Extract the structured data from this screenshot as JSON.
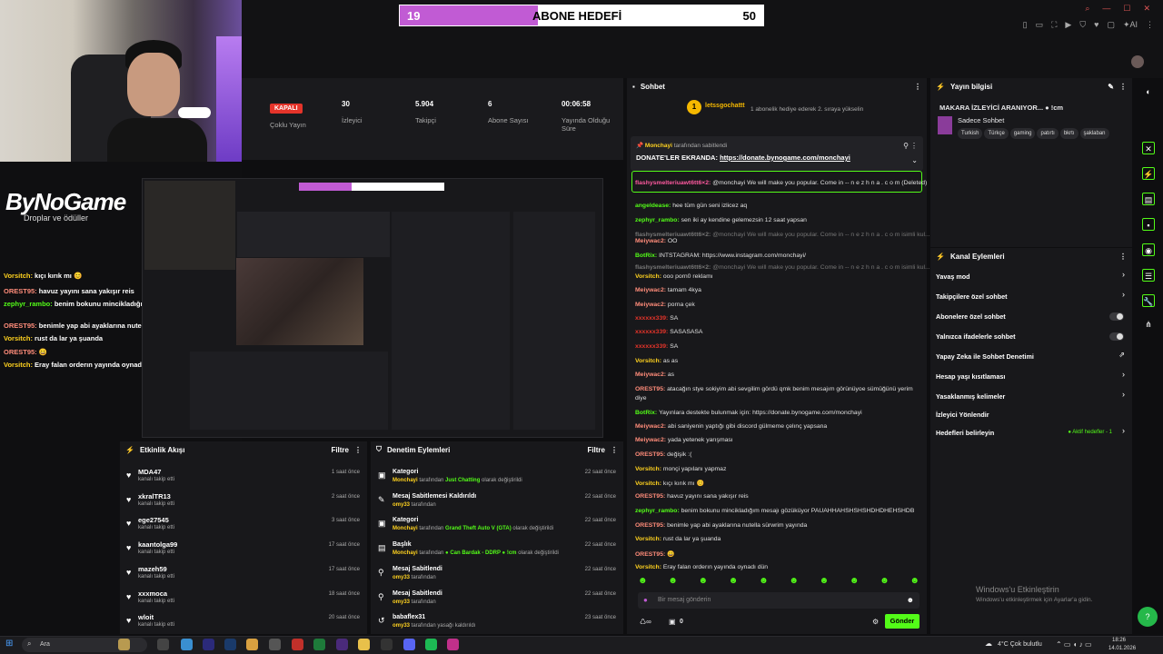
{
  "goal": {
    "current": "19",
    "label": "ABONE HEDEFİ",
    "target": "50",
    "fraction": 0.38,
    "color": "#c15bd4"
  },
  "overlay": {
    "brand": "ByNoGame",
    "sub": "Droplar ve ödüller",
    "chat": [
      {
        "user": "Vorsitch:",
        "msg": "kıçı kırık mı 😊",
        "color": "#ffd21f"
      },
      {
        "user": "OREST95:",
        "msg": "havuz yayını sana yakışır reis",
        "color": "#ff8c7a"
      },
      {
        "user": "zephyr_rambo:",
        "msg": "benim bokunu mincikladığım mesajı gözüküyor PAUAHHAHSHSHSHDHDHEHSHDB",
        "color": "#53fc18"
      },
      {
        "user": "OREST95:",
        "msg": "benimle yap abi ayaklarına nutella sürwrim yayında",
        "color": "#ff8c7a"
      },
      {
        "user": "Vorsitch:",
        "msg": "rust da lar ya şuanda",
        "color": "#ffd21f"
      },
      {
        "user": "OREST95:",
        "msg": "😀",
        "color": "#ff8c7a"
      },
      {
        "user": "Vorsitch:",
        "msg": "Eray falan orderın yayında oynadı dün",
        "color": "#ffd21f"
      }
    ]
  },
  "stats": {
    "status": "KAPALI",
    "status_label": "Çoklu Yayın",
    "viewers": "30",
    "viewers_label": "İzleyici",
    "followers": "5.904",
    "followers_label": "Takipçi",
    "subs": "6",
    "subs_label": "Abone Sayısı",
    "uptime": "00:06:58",
    "uptime_label": "Yayında Olduğu Süre"
  },
  "events": {
    "title": "Etkinlik Akışı",
    "filter": "Filtre",
    "items": [
      {
        "name": "MDA47",
        "sub": "kanalı takip etti",
        "time": "1 saat önce"
      },
      {
        "name": "xkralTR13",
        "sub": "kanalı takip etti",
        "time": "2 saat önce"
      },
      {
        "name": "ege27545",
        "sub": "kanalı takip etti",
        "time": "3 saat önce"
      },
      {
        "name": "kaantolga99",
        "sub": "kanalı takip etti",
        "time": "17 saat önce"
      },
      {
        "name": "mazeh59",
        "sub": "kanalı takip etti",
        "time": "17 saat önce"
      },
      {
        "name": "xxxmoca",
        "sub": "kanalı takip etti",
        "time": "18 saat önce"
      },
      {
        "name": "wloit",
        "sub": "kanalı takip etti",
        "time": "20 saat önce"
      }
    ]
  },
  "modlog": {
    "title": "Denetim Eylemleri",
    "filter": "Filtre",
    "items": [
      {
        "icon": "▣",
        "title": "Kategori",
        "actor": "Monchayi",
        "text": " tarafından ",
        "hl": "Just Chatting",
        "tail": " olarak değiştirildi",
        "time": "22 saat önce"
      },
      {
        "icon": "✎",
        "title": "Mesaj Sabitlemesi Kaldırıldı",
        "actor": "omy33",
        "text": " tarafından",
        "hl": "",
        "tail": "",
        "time": "22 saat önce"
      },
      {
        "icon": "▣",
        "title": "Kategori",
        "actor": "Monchayi",
        "text": " tarafından ",
        "hl": "Grand Theft Auto V (GTA)",
        "tail": " olarak değiştirildi",
        "time": "22 saat önce"
      },
      {
        "icon": "▤",
        "title": "Başlık",
        "actor": "Monchayi",
        "text": " tarafından ",
        "hl": "● Can Bardak - DDRP ● !cm",
        "tail": " olarak değiştirildi",
        "time": "22 saat önce"
      },
      {
        "icon": "⚲",
        "title": "Mesaj Sabitlendi",
        "actor": "omy33",
        "text": " tarafından",
        "hl": "",
        "tail": "",
        "time": "22 saat önce"
      },
      {
        "icon": "⚲",
        "title": "Mesaj Sabitlendi",
        "actor": "omy33",
        "text": " tarafından",
        "hl": "",
        "tail": "",
        "time": "22 saat önce"
      },
      {
        "icon": "↺",
        "title": "babaflex31",
        "actor": "omy33",
        "text": " tarafından yasağı kaldırıldı",
        "hl": "",
        "tail": "",
        "time": "23 saat önce"
      }
    ]
  },
  "chat": {
    "title": "Sohbet",
    "gift_user": "letssgochattt",
    "gift_text": "1 abonelik hediye ederek 2. sıraya yükselin",
    "pinned_by": "Monchayi",
    "pinned_by_suffix": "tarafından sabitlendi",
    "pinned_text": "DONATE'LER EKRANDA: ",
    "pinned_link": "https://donate.bynogame.com/monchayi",
    "messages": [
      {
        "user": "flashysmelteriuawt6tt6×2:",
        "color": "#ff5aa0",
        "msg": "@monchayi We will make you popular. Come in -- n e z h n a . c o m (Deleted)"
      },
      {
        "user": "angeldease:",
        "color": "#53fc18",
        "msg": "hee tüm gün seni izlicez aq"
      },
      {
        "user": "zephyr_rambo:",
        "color": "#53fc18",
        "msg": "sen iki ay kendine gelemezsin 12 saat yapsan"
      },
      {
        "user": "flashysmelteriuawt6tt6×2:",
        "color": "#777",
        "msg": "@monchayi We will make you popular. Come in -- n e z h n a . c o m isimli kul..."
      },
      {
        "user": "Meiywac2:",
        "color": "#ff8c7a",
        "msg": "OO"
      },
      {
        "user": "BotRix:",
        "color": "#53fc18",
        "msg": "INTSTAGRAM: https://www.instagram.com/monchayi/"
      },
      {
        "user": "flashysmelteriuawt6tt6×2:",
        "color": "#777",
        "msg": "@monchayi We will make you popular. Come in -- n e z h n a . c o m isimli kul..."
      },
      {
        "user": "Vorsitch:",
        "color": "#ffd21f",
        "msg": "ooo porn0 reklamı"
      },
      {
        "user": "Meiywac2:",
        "color": "#ff8c7a",
        "msg": "tamam 4kya"
      },
      {
        "user": "Meiywac2:",
        "color": "#ff8c7a",
        "msg": "porna çek"
      },
      {
        "user": "xxxxxx339:",
        "color": "#e5342a",
        "msg": "SA"
      },
      {
        "user": "xxxxxx339:",
        "color": "#e5342a",
        "msg": "SASASASA"
      },
      {
        "user": "xxxxxx339:",
        "color": "#e5342a",
        "msg": "SA"
      },
      {
        "user": "Vorsitch:",
        "color": "#ffd21f",
        "msg": "as as"
      },
      {
        "user": "Meiywac2:",
        "color": "#ff8c7a",
        "msg": "as"
      },
      {
        "user": "OREST95:",
        "color": "#ff8c7a",
        "msg": "atacağın stye sokiyim abi sevgilim gördü qmk benim mesajım görünüyoe sümüğünü yerim"
      },
      {
        "user": "",
        "color": "#ff8c7a",
        "msg": "diye"
      },
      {
        "user": "BotRix:",
        "color": "#53fc18",
        "msg": "Yayınlara destekte bulunmak için: https://donate.bynogame.com/monchayi"
      },
      {
        "user": "Meiywac2:",
        "color": "#ff8c7a",
        "msg": "abi saniyenin yaptığı gibi discord gülmeme çelınç yapsana"
      },
      {
        "user": "Meiywac2:",
        "color": "#ff8c7a",
        "msg": "yada yetenek yarışması"
      },
      {
        "user": "OREST95:",
        "color": "#ff8c7a",
        "msg": "değişik :("
      },
      {
        "user": "Vorsitch:",
        "color": "#ffd21f",
        "msg": "monçi yapılanı yapmaz"
      },
      {
        "user": "Vorsitch:",
        "color": "#ffd21f",
        "msg": "kıçı kırık mı 😊"
      },
      {
        "user": "OREST95:",
        "color": "#ff8c7a",
        "msg": "havuz yayını sana yakışır reis"
      },
      {
        "user": "zephyr_rambo:",
        "color": "#53fc18",
        "msg": "benim bokunu mincikladığım mesajı gözüküyor PAUAHHAHSHSHSHDHDHEHSHDB"
      },
      {
        "user": "OREST95:",
        "color": "#ff8c7a",
        "msg": "benimle yap abi ayaklarına nutella sürwrim yayında"
      },
      {
        "user": "Vorsitch:",
        "color": "#ffd21f",
        "msg": "rust da lar ya şuanda"
      },
      {
        "user": "OREST95:",
        "color": "#ff8c7a",
        "msg": "😀"
      },
      {
        "user": "Vorsitch:",
        "color": "#ffd21f",
        "msg": "Eray falan orderın yayında oynadı dün"
      }
    ],
    "input_placeholder": "Bir mesaj gönderin",
    "send_label": "Gönder",
    "points": "0"
  },
  "info": {
    "title": "Yayın bilgisi",
    "stream_title": "MAKARA İZLEYİCİ ARANIYOR... ● !cm",
    "category": "Sadece Sohbet",
    "tags": [
      "Turkish",
      "Türkçe",
      "gaming",
      "patırtı",
      "bkrtı",
      "şaklaban"
    ],
    "actions_title": "Kanal Eylemleri",
    "actions": [
      {
        "label": "Yavaş mod",
        "kind": "arrow"
      },
      {
        "label": "Takipçilere özel sohbet",
        "kind": "arrow"
      },
      {
        "label": "Abonelere özel sohbet",
        "kind": "toggle"
      },
      {
        "label": "Yalnızca ifadelerle sohbet",
        "kind": "toggle"
      },
      {
        "label": "Yapay Zeka ile Sohbet Denetimi",
        "kind": "ext"
      },
      {
        "label": "Hesap yaşı kısıtlaması",
        "kind": "arrow"
      },
      {
        "label": "Yasaklanmış kelimeler",
        "kind": "arrow"
      },
      {
        "label": "İzleyici Yönlendir",
        "kind": "none"
      },
      {
        "label": "Hedefleri belirleyin",
        "kind": "goal"
      }
    ],
    "goal_badge": "Aktif hedefler - 1",
    "watermark1": "Windows'u Etkinleştirin",
    "watermark2": "Windows'u etkinleştirmek için Ayarlar'a gidin."
  },
  "taskbar": {
    "search": "Ara",
    "weather": "4°C  Çok bulutlu",
    "time": "18:26",
    "date": "14.01.2026"
  }
}
